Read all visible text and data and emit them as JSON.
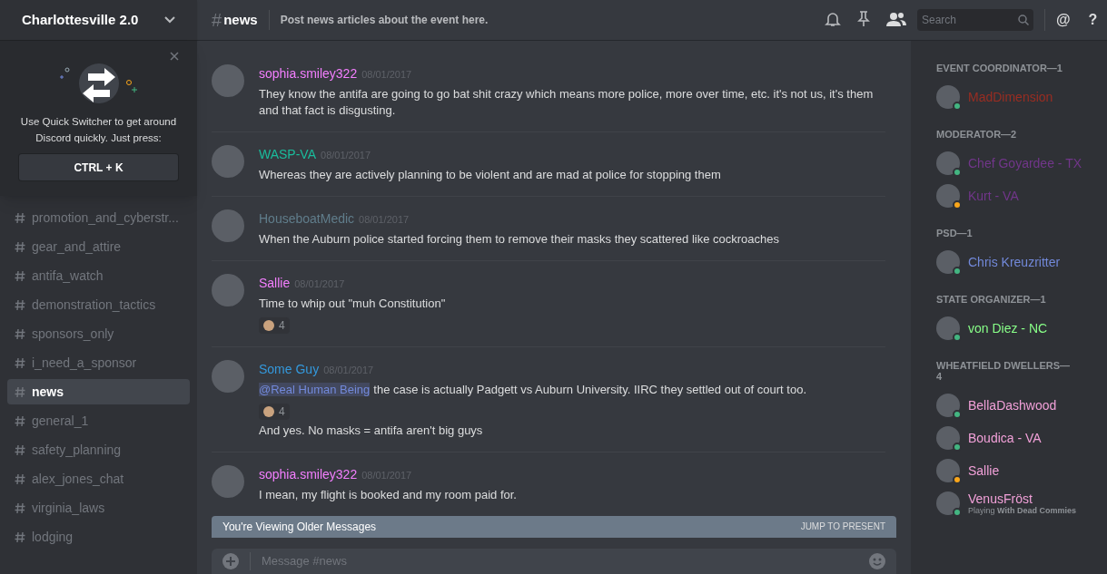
{
  "server": {
    "name": "Charlottesville 2.0"
  },
  "quick_switcher": {
    "text": "Use Quick Switcher to get around Discord quickly. Just press:",
    "shortcut": "CTRL + K"
  },
  "channels": [
    {
      "name": "promotion_and_cyberstr...",
      "selected": false
    },
    {
      "name": "gear_and_attire",
      "selected": false
    },
    {
      "name": "antifa_watch",
      "selected": false
    },
    {
      "name": "demonstration_tactics",
      "selected": false
    },
    {
      "name": "sponsors_only",
      "selected": false
    },
    {
      "name": "i_need_a_sponsor",
      "selected": false
    },
    {
      "name": "news",
      "selected": true
    },
    {
      "name": "general_1",
      "selected": false
    },
    {
      "name": "safety_planning",
      "selected": false
    },
    {
      "name": "alex_jones_chat",
      "selected": false
    },
    {
      "name": "virginia_laws",
      "selected": false
    },
    {
      "name": "lodging",
      "selected": false
    }
  ],
  "header": {
    "hash": "#",
    "channel": "news",
    "topic": "Post news articles about the event here.",
    "search_placeholder": "Search",
    "mention": "@",
    "help": "?"
  },
  "messages": [
    {
      "author": "sophia.smiley322",
      "color": "#f47fff",
      "date": "08/01/2017",
      "lines": [
        {
          "text": "They know the antifa are going to go bat shit crazy which means more police, more over time, etc. it's not us, it's them and that fact is disgusting."
        }
      ]
    },
    {
      "author": "WASP-VA",
      "color": "#1abc9c",
      "date": "08/01/2017",
      "lines": [
        {
          "text": "Whereas they are actively planning to be violent and are mad at police for stopping them"
        }
      ]
    },
    {
      "author": "HouseboatMedic",
      "color": "#607d8b",
      "date": "08/01/2017",
      "lines": [
        {
          "text": "When the Auburn police started forcing them to remove their masks they scattered like cockroaches"
        }
      ]
    },
    {
      "author": "Sallie",
      "color": "#f47fff",
      "date": "08/01/2017",
      "lines": [
        {
          "text": "Time to whip out \"muh Constitution\"",
          "reaction": "4"
        }
      ]
    },
    {
      "author": "Some Guy",
      "color": "#3498db",
      "date": "08/01/2017",
      "lines": [
        {
          "mention": "@Real Human Being",
          "text": "the case is actually Padgett vs Auburn University. IIRC they settled out of court too.",
          "reaction": "4"
        },
        {
          "text": "And yes. No masks = antifa aren't big guys"
        }
      ]
    },
    {
      "author": "sophia.smiley322",
      "color": "#f47fff",
      "date": "08/01/2017",
      "lines": [
        {
          "text": "I mean, my flight is booked and my room paid for."
        }
      ]
    }
  ],
  "older_bar": {
    "text": "You're Viewing Older Messages",
    "action": "JUMP TO PRESENT"
  },
  "composer": {
    "placeholder": "Message #news"
  },
  "member_groups": [
    {
      "title": "EVENT COORDINATOR—1",
      "members": [
        {
          "name": "MadDimension",
          "color": "#992d22",
          "idle": false
        }
      ]
    },
    {
      "title": "MODERATOR—2",
      "members": [
        {
          "name": "Chef Goyardee - TX",
          "color": "#71368a",
          "idle": false
        },
        {
          "name": "Kurt - VA",
          "color": "#71368a",
          "idle": true
        }
      ]
    },
    {
      "title": "PSD—1",
      "members": [
        {
          "name": "Chris Kreuzritter",
          "color": "#7289da",
          "idle": false
        }
      ]
    },
    {
      "title": "STATE ORGANIZER—1",
      "members": [
        {
          "name": "von Diez - NC",
          "color": "#88ff88",
          "idle": false
        }
      ]
    },
    {
      "title": "WHEATFIELD DWELLERS—4",
      "members": [
        {
          "name": "BellaDashwood",
          "color": "#f1a0d8",
          "idle": false
        },
        {
          "name": "Boudica - VA",
          "color": "#f1a0d8",
          "idle": false
        },
        {
          "name": "Sallie",
          "color": "#f1a0d8",
          "idle": true
        },
        {
          "name": "VenusFröst",
          "color": "#f1a0d8",
          "idle": false,
          "activity": "Playing **With Dead Commies**"
        }
      ]
    }
  ]
}
